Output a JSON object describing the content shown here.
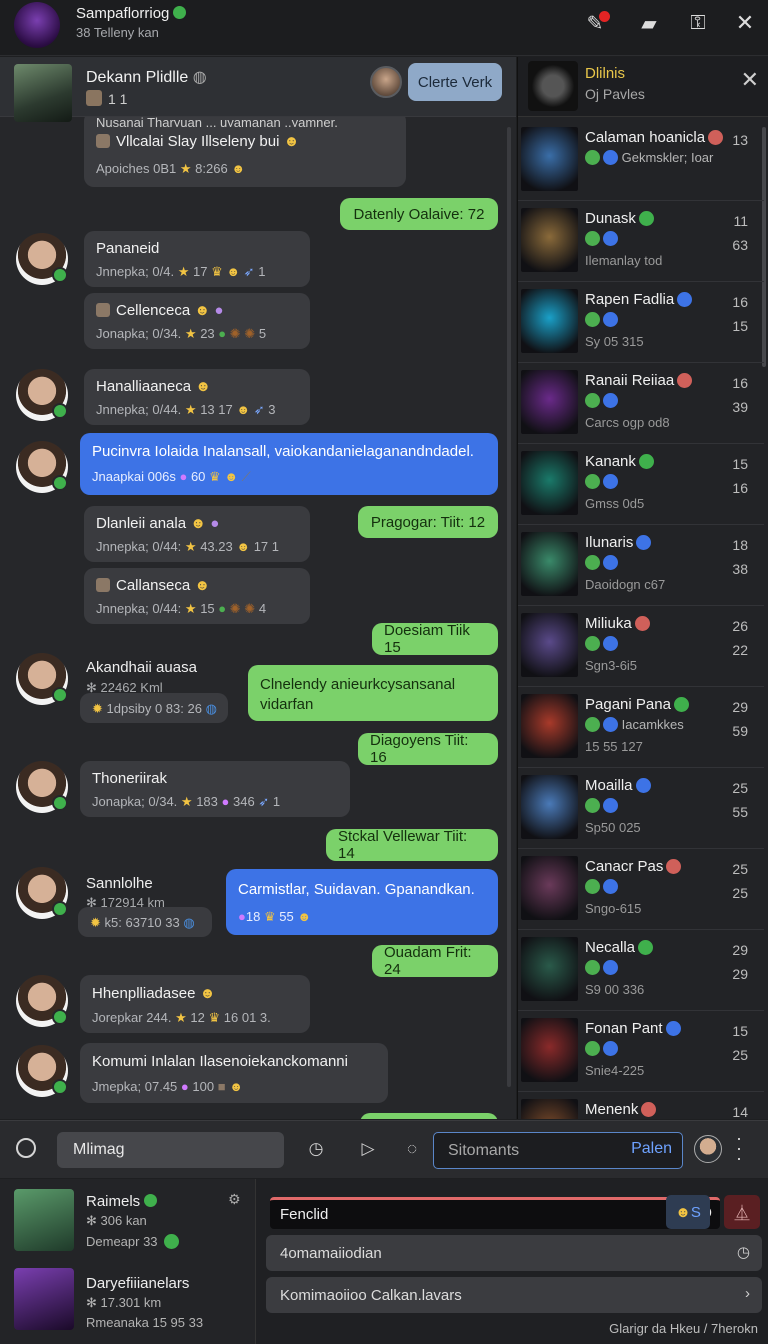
{
  "topbar": {
    "title": "Sampaflorriog",
    "subtitle": "38 Telleny kan",
    "icons": [
      "pencil-badge-icon",
      "chat-bubbles-icon",
      "profile-lock-icon",
      "close-icon"
    ]
  },
  "chat_header": {
    "title": "Dekann Plidlle",
    "sub": "1 1",
    "button_label": "Clerte Verk"
  },
  "messages": {
    "m0": {
      "cut_title": "Nusanai Tharyuan ... uyamanan ..yamner.",
      "title": "Vllcalai Slay Illseleny bui",
      "meta": "Apoiches 0B1"
    },
    "m0_meta2": "8:266",
    "g1": "Datenly Oalaive: 72",
    "m1": {
      "name": "Pananeid",
      "meta": "Jnnepka; 0/4.",
      "n": "17",
      "n2": "1"
    },
    "m2": {
      "name": "Cellenceca",
      "meta": "Jonapka; 0/34.",
      "n": "23",
      "n2": "5"
    },
    "m3": {
      "name": "Hanalliaaneca",
      "meta": "Jnnepka; 0/44.",
      "n": "13 17",
      "n2": "3"
    },
    "m4": {
      "text": "Pucinvra Iolaida Inalansall, vaiokandanielaganandndadel.",
      "meta": "Jnaapkai 006s",
      "n": "60"
    },
    "g2": "Pragogar: Tiit: 12",
    "m5": {
      "name": "Dlanleii anala",
      "meta": "Jnnepka; 0/44:",
      "n": "43.23",
      "n2": "17 1"
    },
    "m6": {
      "name": "Callanseca",
      "meta": "Jnnepka; 0/44:",
      "n": "15",
      "n2": "4"
    },
    "g3": "Doesiam Tiik 15",
    "m7": {
      "name": "Akandhaii auasa",
      "sub": "22462 Kml",
      "meta": "1dpsiby 0 83: 26"
    },
    "g4": "Clnelendy anieurkcysansanal vidarfan",
    "g5": "Diagoyens Tiit: 16",
    "m8": {
      "name": "Thoneriirak",
      "meta": "Jonapka; 0/34.",
      "n": "183",
      "n2": "346",
      "n3": "1"
    },
    "g6": "Stckal Vellewar Tiit: 14",
    "m9": {
      "name": "Sannlolhe",
      "sub": "172914 km",
      "meta": "k5: 63710 33"
    },
    "m10": {
      "text": "Carmistlar, Suidavan. Gpanandkan.",
      "meta": "18",
      "n": "55"
    },
    "g7": "Ouadam Frit: 24",
    "m11": {
      "name": "Hhenplliadasee",
      "meta": "Jorepkar 244.",
      "n": "12",
      "n2": "16 01 3."
    },
    "m12": {
      "text": "Komumi Inlalan Ilasenoiekanckomanni",
      "meta": "Jmepka; 07.45",
      "n": "100"
    }
  },
  "panel": {
    "title": "Dlilnis",
    "subtitle": "Oj Pavles",
    "items": [
      {
        "name": "Calaman hoanicla",
        "line2": "Gekmskler; Ioar",
        "line3": "",
        "n1": "13",
        "n2": "",
        "thumb": "#3a6ea8"
      },
      {
        "name": "Dunask",
        "line2": "",
        "line3": "Ilemanlay tod",
        "n1": "11",
        "n2": "63",
        "thumb": "#8a6a3a"
      },
      {
        "name": "Rapen Fadlia",
        "line2": "",
        "line3": "Sy 05 315",
        "n1": "16",
        "n2": "15",
        "thumb": "#1aa0c8"
      },
      {
        "name": "Ranaii Reiiaa",
        "line2": "",
        "line3": "Carcs ogp od8",
        "n1": "16",
        "n2": "39",
        "thumb": "#6a2a8a"
      },
      {
        "name": "Kanank",
        "line2": "",
        "line3": "Gmss 0d5",
        "n1": "15",
        "n2": "16",
        "thumb": "#1a7a6a"
      },
      {
        "name": "Ilunaris",
        "line2": "",
        "line3": "Daoidogn c67",
        "n1": "18",
        "n2": "38",
        "thumb": "#3a8a6a"
      },
      {
        "name": "Miliuka",
        "line2": "",
        "line3": "Sgn3-6i5",
        "n1": "26",
        "n2": "22",
        "thumb": "#5a4a8a"
      },
      {
        "name": "Pagani Pana",
        "line2": "Iacamkkes",
        "line3": "15 55 127",
        "n1": "29",
        "n2": "59",
        "thumb": "#a83a2a"
      },
      {
        "name": "Moailla",
        "line2": "",
        "line3": "Sp50 025",
        "n1": "25",
        "n2": "55",
        "thumb": "#4a7ab8"
      },
      {
        "name": "Canacr Pas",
        "line2": "",
        "line3": "Sngo-615",
        "n1": "25",
        "n2": "25",
        "thumb": "#6a3a5a"
      },
      {
        "name": "Necalla",
        "line2": "",
        "line3": "S9 00 336",
        "n1": "29",
        "n2": "29",
        "thumb": "#2a5a4a"
      },
      {
        "name": "Fonan Pant",
        "line2": "",
        "line3": "Snie4-225",
        "n1": "15",
        "n2": "25",
        "thumb": "#8a2a2a"
      },
      {
        "name": "Menenk",
        "line2": "",
        "line3": "",
        "n1": "14",
        "n2": "",
        "thumb": "#7a4a2a"
      }
    ]
  },
  "composer": {
    "input_value": "Mlimag",
    "search_placeholder": "Sitomants",
    "search_button": "Palen"
  },
  "bottom_left": [
    {
      "name": "Raimels",
      "sub": "306 kan",
      "meta": "Demeapr 33"
    },
    {
      "name": "Daryefiiianelars",
      "sub": "17.301 km",
      "meta": "Rmeanaka 15 95 33"
    }
  ],
  "bottom_right": {
    "bar_text": "Fenclid",
    "bar_end": "O",
    "row1": "4omamaiiodian",
    "row2": "Komimaoiioo Calkan.lavars",
    "footer": "Glarigr da Hkeu / 7herokn"
  },
  "colors": {
    "accent_green": "#7bd16a",
    "accent_blue": "#3d73e6",
    "verified": "#3fb04c"
  }
}
